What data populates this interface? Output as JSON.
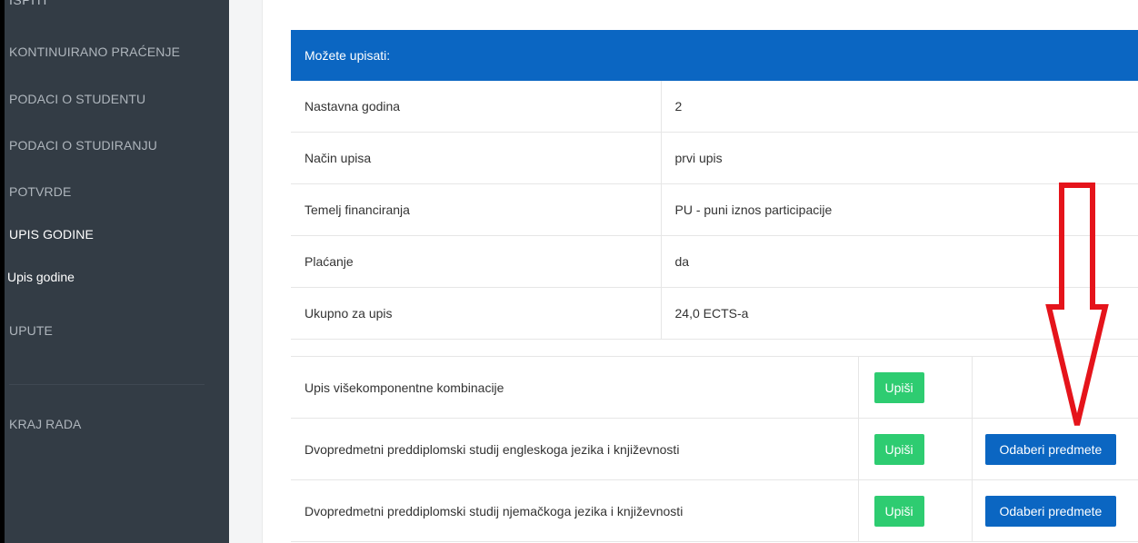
{
  "sidebar": {
    "cut_item": "ISPITI",
    "items": [
      {
        "label": "KONTINUIRANO PRAĆENJE"
      },
      {
        "label": "PODACI O STUDENTU"
      },
      {
        "label": "PODACI O STUDIRANJU"
      },
      {
        "label": "POTVRDE"
      },
      {
        "label": "UPIS GODINE"
      },
      {
        "label": "Upis godine"
      },
      {
        "label": "UPUTE"
      },
      {
        "label": "KRAJ RADA"
      }
    ]
  },
  "panel": {
    "title": "Možete upisati:",
    "rows": [
      {
        "label": "Nastavna godina",
        "value": "2"
      },
      {
        "label": "Način upisa",
        "value": "prvi upis"
      },
      {
        "label": "Temelj financiranja",
        "value": "PU - puni iznos participacije"
      },
      {
        "label": "Plaćanje",
        "value": "da"
      },
      {
        "label": "Ukupno za upis",
        "value": "24,0 ECTS-a"
      }
    ]
  },
  "combos": [
    {
      "name": "Upis višekomponentne kombinacije",
      "enroll": "Upiši",
      "choose": ""
    },
    {
      "name": "Dvopredmetni preddiplomski studij engleskoga jezika i književnosti",
      "enroll": "Upiši",
      "choose": "Odaberi predmete"
    },
    {
      "name": "Dvopredmetni preddiplomski studij njemačkoga jezika i književnosti",
      "enroll": "Upiši",
      "choose": "Odaberi predmete"
    }
  ],
  "colors": {
    "sidebar": "#333c45",
    "primary": "#0b66c2",
    "success": "#2ecc71",
    "annotation_arrow": "#e5141b"
  }
}
